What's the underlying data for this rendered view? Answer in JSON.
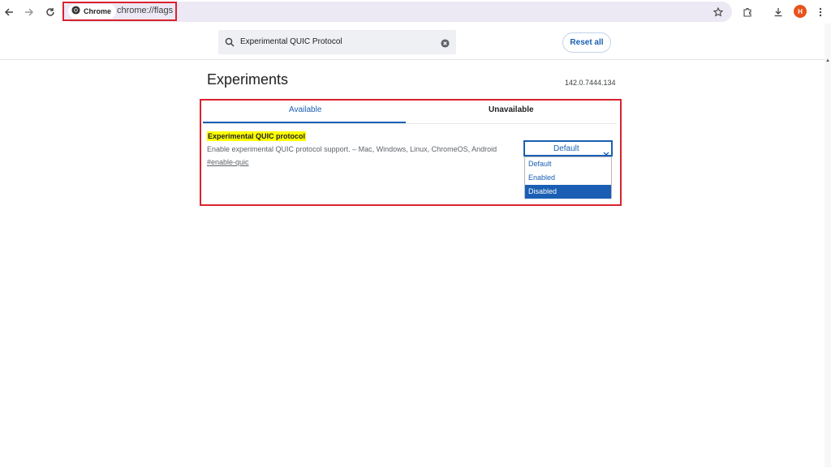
{
  "browser": {
    "chip_label": "Chrome",
    "url": "chrome://flags",
    "avatar_initial": "H",
    "icons": [
      "back-icon",
      "forward-icon",
      "reload-icon",
      "chrome-logo-icon",
      "bookmark-star-icon",
      "extensions-icon",
      "download-icon",
      "more-menu-icon"
    ],
    "colors": {
      "omnibox_bg": "#ece8f4",
      "avatar_bg": "#e8531c",
      "highlight": "#d9232e"
    }
  },
  "flags": {
    "search_value": "Experimental QUIC Protocol",
    "reset_label": "Reset all",
    "title": "Experiments",
    "version": "142.0.7444.134",
    "tabs": [
      {
        "label": "Available",
        "active": true
      },
      {
        "label": "Unavailable",
        "active": false
      }
    ],
    "experiment": {
      "name": "Experimental QUIC protocol",
      "description": "Enable experimental QUIC protocol support. – Mac, Windows, Linux, ChromeOS, Android",
      "link": "#enable-quic",
      "selected": "Default",
      "options": [
        "Default",
        "Enabled",
        "Disabled"
      ],
      "hovered_option": "Disabled"
    },
    "colors": {
      "accent": "#1a5fb4",
      "highlight_text_bg": "#ffff00"
    }
  }
}
